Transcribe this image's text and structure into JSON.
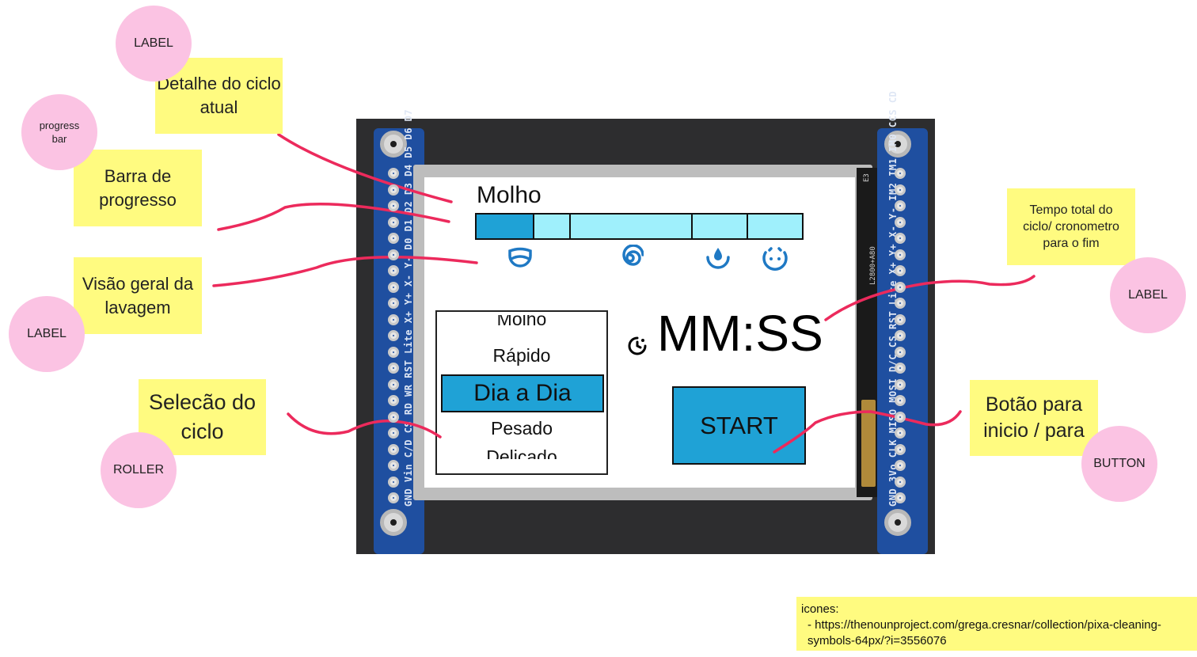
{
  "screen": {
    "cycle_detail": "Molho",
    "progress": {
      "segments": [
        {
          "color": "#1fa2d6",
          "state": "done"
        },
        {
          "color": "#9ff0fc",
          "state": "pending"
        },
        {
          "color": "#9ff0fc",
          "state": "pending"
        },
        {
          "color": "#9ff0fc",
          "state": "pending"
        },
        {
          "color": "#9ff0fc",
          "state": "pending"
        }
      ]
    },
    "overview_icons": [
      "soak-icon",
      "spin-icon",
      "rinse-icon",
      "done-icon"
    ],
    "roller": {
      "options": [
        "Molho",
        "Rápido",
        "Dia a Dia",
        "Pesado",
        "Delicado"
      ],
      "selected": "Dia a Dia"
    },
    "timer": "MM:SS",
    "start_button": "START"
  },
  "annotations": {
    "cycle_detail": {
      "tag": "LABEL",
      "note": "Detalhe do ciclo atual"
    },
    "progress": {
      "tag": "progress bar",
      "note": "Barra de progresso"
    },
    "overview": {
      "tag": "LABEL",
      "note": "Visão geral da lavagem"
    },
    "selection": {
      "tag": "ROLLER",
      "note": "Selecão do ciclo"
    },
    "time": {
      "tag": "LABEL",
      "note": "Tempo total do ciclo/ cronometro para o fim"
    },
    "start": {
      "tag": "BUTTON",
      "note": "Botão para inicio / para"
    }
  },
  "icons_note": {
    "title": "icones:",
    "item": "-  https://thenounproject.com/grega.cresnar/collection/pixa-cleaning-symbols-64px/?i=3556076"
  },
  "board": {
    "left_pins": "GND Vin C/D CS RD WR RST Lite X+ Y+ X- Y- D0 D1 D2 D3 D4 D5 D6 D7",
    "right_pins": "GND 3Vo CLK MISO MOSI D/C CS RST Lite X+ Y+ X- Y- IM2 IM1 IM0 CCS CD",
    "flex_text": "L2800+A80",
    "flex_corner": "E3"
  },
  "colors": {
    "accent_blue": "#1fa2d6",
    "light_cyan": "#9ff0fc",
    "sticky_yellow": "#fffb80",
    "tag_pink": "#fbc3e3",
    "connector_red": "#ec2a5c",
    "pcb_blue": "#1f4fa0"
  }
}
